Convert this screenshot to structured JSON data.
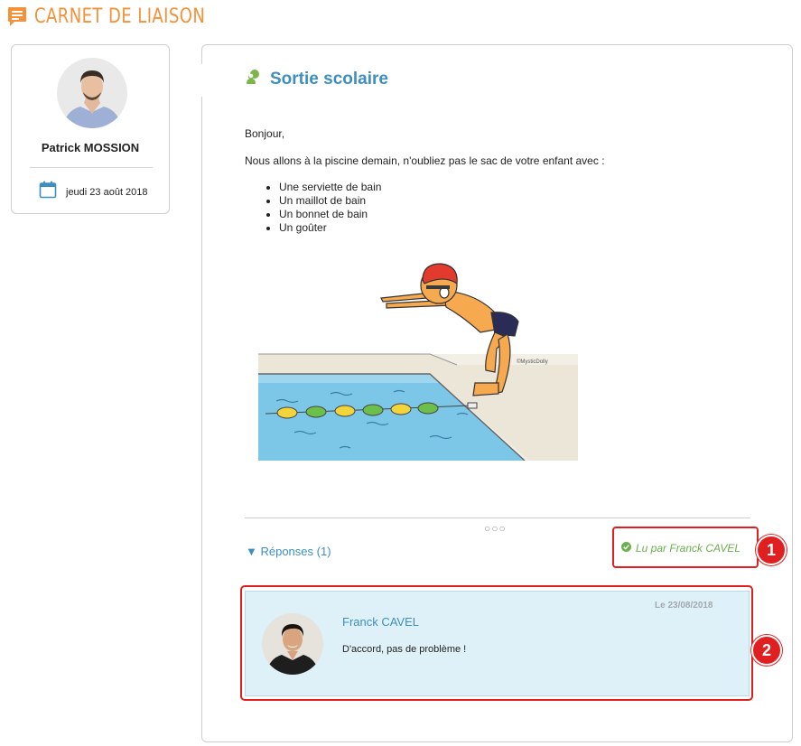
{
  "header": {
    "title": "CARNET DE LIAISON",
    "icon": "message-icon",
    "color": "#f4923a"
  },
  "author": {
    "name": "Patrick MOSSION",
    "date": "jeudi 23 août 2018",
    "date_icon": "calendar-icon"
  },
  "message": {
    "title": "Sortie scolaire",
    "title_icon": "outing-icon",
    "greeting": "Bonjour,",
    "intro": "Nous allons à la piscine demain, n'oubliez pas le sac de votre enfant avec :",
    "items": [
      "Une serviette de bain",
      "Un maillot de bain",
      "Un bonnet de bain",
      "Un goûter"
    ],
    "illustration_signature": "©MysticDolly"
  },
  "expand_dots": "○○○",
  "replies": {
    "toggle_label": "▼ Réponses (1)"
  },
  "read_status": {
    "text": "Lu par Franck CAVEL",
    "icon": "check-circle-icon",
    "color": "#6ab04c"
  },
  "reply": {
    "author": "Franck CAVEL",
    "date": "Le 23/08/2018",
    "text": "D'accord, pas de problème !"
  },
  "annotations": {
    "badge_1": "1",
    "badge_2": "2",
    "color": "#e02020"
  }
}
